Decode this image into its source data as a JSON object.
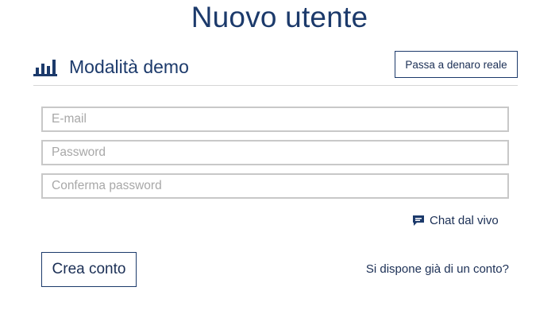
{
  "header": {
    "title": "Nuovo utente"
  },
  "mode_bar": {
    "icon": "bar-chart-icon",
    "label": "Modalità demo",
    "switch_button_label": "Passa a denaro reale"
  },
  "form": {
    "email": {
      "placeholder": "E-mail",
      "value": ""
    },
    "password": {
      "placeholder": "Password",
      "value": ""
    },
    "confirm_password": {
      "placeholder": "Conferma password",
      "value": ""
    }
  },
  "chat": {
    "icon": "chat-bubble-icon",
    "label": "Chat dal vivo"
  },
  "actions": {
    "create_account_label": "Crea conto",
    "existing_account_label": "Si dispone già di un conto?"
  },
  "colors": {
    "accent": "#1c3a6b",
    "field_border": "#c8c8c8",
    "divider": "#d6d6d6"
  }
}
